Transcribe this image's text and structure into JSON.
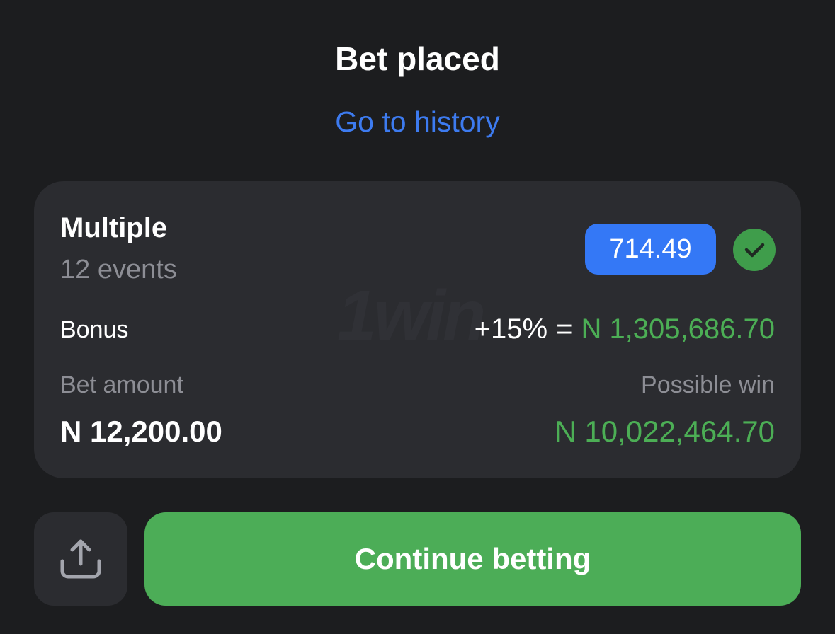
{
  "header": {
    "title": "Bet placed",
    "history_link": "Go to history"
  },
  "bet": {
    "type": "Multiple",
    "events": "12 events",
    "odds": "714.49",
    "status_icon": "check-icon",
    "watermark": "1win",
    "bonus_label": "Bonus",
    "bonus_percent": "+15%",
    "bonus_equals": "=",
    "bonus_value": "N 1,305,686.70",
    "amount_label": "Bet amount",
    "amount_value": "N 12,200.00",
    "win_label": "Possible win",
    "win_value": "N 10,022,464.70"
  },
  "actions": {
    "share_icon": "share-icon",
    "continue_label": "Continue betting"
  },
  "colors": {
    "background": "#1c1d1f",
    "card": "#2b2c30",
    "link_blue": "#3d7bf0",
    "badge_blue": "#3478f6",
    "success_green": "#4cae55",
    "muted_text": "#8d8e95"
  }
}
